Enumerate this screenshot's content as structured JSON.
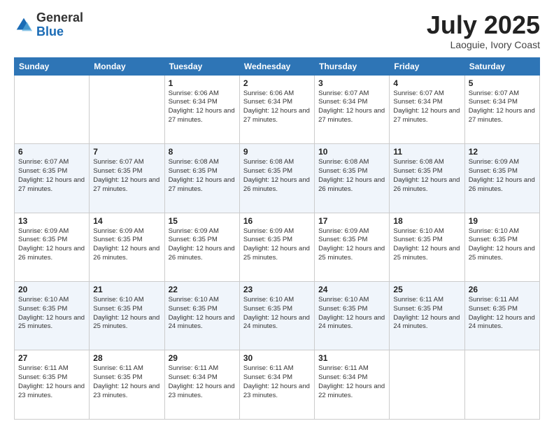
{
  "logo": {
    "general": "General",
    "blue": "Blue"
  },
  "header": {
    "month": "July 2025",
    "location": "Laoguie, Ivory Coast"
  },
  "weekdays": [
    "Sunday",
    "Monday",
    "Tuesday",
    "Wednesday",
    "Thursday",
    "Friday",
    "Saturday"
  ],
  "weeks": [
    [
      {
        "day": "",
        "info": ""
      },
      {
        "day": "",
        "info": ""
      },
      {
        "day": "1",
        "info": "Sunrise: 6:06 AM\nSunset: 6:34 PM\nDaylight: 12 hours and 27 minutes."
      },
      {
        "day": "2",
        "info": "Sunrise: 6:06 AM\nSunset: 6:34 PM\nDaylight: 12 hours and 27 minutes."
      },
      {
        "day": "3",
        "info": "Sunrise: 6:07 AM\nSunset: 6:34 PM\nDaylight: 12 hours and 27 minutes."
      },
      {
        "day": "4",
        "info": "Sunrise: 6:07 AM\nSunset: 6:34 PM\nDaylight: 12 hours and 27 minutes."
      },
      {
        "day": "5",
        "info": "Sunrise: 6:07 AM\nSunset: 6:34 PM\nDaylight: 12 hours and 27 minutes."
      }
    ],
    [
      {
        "day": "6",
        "info": "Sunrise: 6:07 AM\nSunset: 6:35 PM\nDaylight: 12 hours and 27 minutes."
      },
      {
        "day": "7",
        "info": "Sunrise: 6:07 AM\nSunset: 6:35 PM\nDaylight: 12 hours and 27 minutes."
      },
      {
        "day": "8",
        "info": "Sunrise: 6:08 AM\nSunset: 6:35 PM\nDaylight: 12 hours and 27 minutes."
      },
      {
        "day": "9",
        "info": "Sunrise: 6:08 AM\nSunset: 6:35 PM\nDaylight: 12 hours and 26 minutes."
      },
      {
        "day": "10",
        "info": "Sunrise: 6:08 AM\nSunset: 6:35 PM\nDaylight: 12 hours and 26 minutes."
      },
      {
        "day": "11",
        "info": "Sunrise: 6:08 AM\nSunset: 6:35 PM\nDaylight: 12 hours and 26 minutes."
      },
      {
        "day": "12",
        "info": "Sunrise: 6:09 AM\nSunset: 6:35 PM\nDaylight: 12 hours and 26 minutes."
      }
    ],
    [
      {
        "day": "13",
        "info": "Sunrise: 6:09 AM\nSunset: 6:35 PM\nDaylight: 12 hours and 26 minutes."
      },
      {
        "day": "14",
        "info": "Sunrise: 6:09 AM\nSunset: 6:35 PM\nDaylight: 12 hours and 26 minutes."
      },
      {
        "day": "15",
        "info": "Sunrise: 6:09 AM\nSunset: 6:35 PM\nDaylight: 12 hours and 26 minutes."
      },
      {
        "day": "16",
        "info": "Sunrise: 6:09 AM\nSunset: 6:35 PM\nDaylight: 12 hours and 25 minutes."
      },
      {
        "day": "17",
        "info": "Sunrise: 6:09 AM\nSunset: 6:35 PM\nDaylight: 12 hours and 25 minutes."
      },
      {
        "day": "18",
        "info": "Sunrise: 6:10 AM\nSunset: 6:35 PM\nDaylight: 12 hours and 25 minutes."
      },
      {
        "day": "19",
        "info": "Sunrise: 6:10 AM\nSunset: 6:35 PM\nDaylight: 12 hours and 25 minutes."
      }
    ],
    [
      {
        "day": "20",
        "info": "Sunrise: 6:10 AM\nSunset: 6:35 PM\nDaylight: 12 hours and 25 minutes."
      },
      {
        "day": "21",
        "info": "Sunrise: 6:10 AM\nSunset: 6:35 PM\nDaylight: 12 hours and 25 minutes."
      },
      {
        "day": "22",
        "info": "Sunrise: 6:10 AM\nSunset: 6:35 PM\nDaylight: 12 hours and 24 minutes."
      },
      {
        "day": "23",
        "info": "Sunrise: 6:10 AM\nSunset: 6:35 PM\nDaylight: 12 hours and 24 minutes."
      },
      {
        "day": "24",
        "info": "Sunrise: 6:10 AM\nSunset: 6:35 PM\nDaylight: 12 hours and 24 minutes."
      },
      {
        "day": "25",
        "info": "Sunrise: 6:11 AM\nSunset: 6:35 PM\nDaylight: 12 hours and 24 minutes."
      },
      {
        "day": "26",
        "info": "Sunrise: 6:11 AM\nSunset: 6:35 PM\nDaylight: 12 hours and 24 minutes."
      }
    ],
    [
      {
        "day": "27",
        "info": "Sunrise: 6:11 AM\nSunset: 6:35 PM\nDaylight: 12 hours and 23 minutes."
      },
      {
        "day": "28",
        "info": "Sunrise: 6:11 AM\nSunset: 6:35 PM\nDaylight: 12 hours and 23 minutes."
      },
      {
        "day": "29",
        "info": "Sunrise: 6:11 AM\nSunset: 6:34 PM\nDaylight: 12 hours and 23 minutes."
      },
      {
        "day": "30",
        "info": "Sunrise: 6:11 AM\nSunset: 6:34 PM\nDaylight: 12 hours and 23 minutes."
      },
      {
        "day": "31",
        "info": "Sunrise: 6:11 AM\nSunset: 6:34 PM\nDaylight: 12 hours and 22 minutes."
      },
      {
        "day": "",
        "info": ""
      },
      {
        "day": "",
        "info": ""
      }
    ]
  ]
}
